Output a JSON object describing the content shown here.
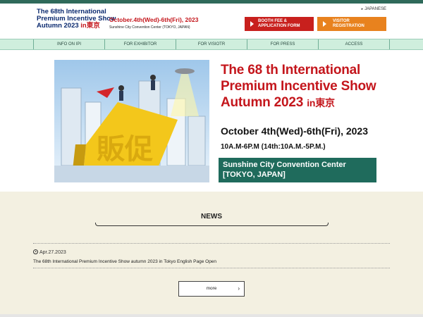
{
  "header": {
    "logo_line1": "The 68th International",
    "logo_line2": "Premium Incentive Show",
    "logo_line3": "Autumn 2023",
    "logo_in_tokyo": "in東京",
    "date_line": "October.4th(Wed)-6th(Fri), 2023",
    "venue_line": "Sunshine City Convention Center (TOKYO, JAPAN)",
    "language_link": "JAPANESE",
    "booth_button_line1": "BOOTH FEE &",
    "booth_button_line2": "APPLICATION FORM",
    "visitor_button_line1": "VISITOR",
    "visitor_button_line2": "REGISTRATION"
  },
  "nav": {
    "items": [
      {
        "label": "INFO ON IPI"
      },
      {
        "label": "FOR EXHIBITOR"
      },
      {
        "label": "FOR VISIOTR"
      },
      {
        "label": "FOR PRESS"
      },
      {
        "label": "ACCESS"
      }
    ]
  },
  "hero": {
    "title_line1": "The 68 th International",
    "title_line2": "Premium Incentive Show",
    "title_line3": "Autumn 2023",
    "title_in_tokyo": "in東京",
    "date_main": "October 4th(Wed)-6th(Fri), 2023",
    "time": "10A.M-6P.M (14th:10A.M.-5P.M.)",
    "venue_line1": "Sunshine City Convention Center",
    "venue_line2": "[TOKYO, JAPAN]",
    "illustration_text": "販促"
  },
  "news": {
    "title": "NEWS",
    "items": [
      {
        "date": "Apr.27.2023",
        "text": "The 68th International Premium Incentive Show autumn 2023 in Tokyo English Page Open"
      }
    ],
    "more_label": "more"
  },
  "colors": {
    "topbar": "#2f6a5a",
    "brand_red": "#c4161c",
    "logo_blue": "#0b2a6f",
    "booth_button": "#c8201d",
    "visitor_button": "#e8821e",
    "nav_bg": "#cfeedd",
    "venue_box": "#1f6b5c",
    "news_bg": "#f3f0e1"
  }
}
